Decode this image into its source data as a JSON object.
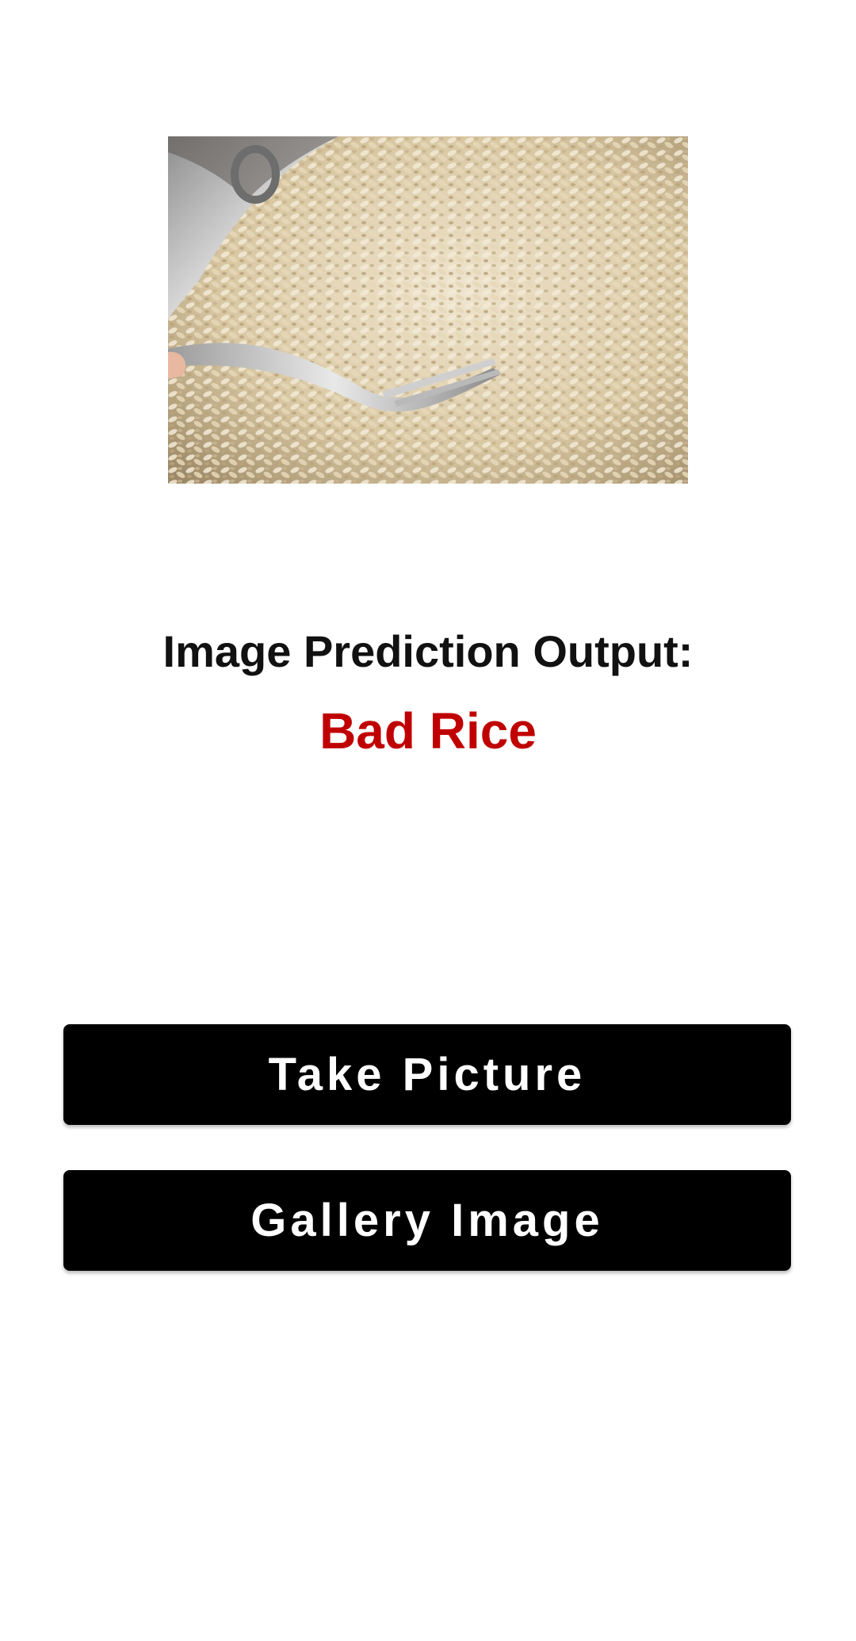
{
  "preview": {
    "image_name": "rice-photo",
    "description_icon": "fork-in-rice-image"
  },
  "result": {
    "label": "Image Prediction Output:",
    "value": "Bad Rice",
    "value_color": "#c00000"
  },
  "actions": {
    "take_picture_label": "Take Picture",
    "gallery_image_label": "Gallery Image",
    "button_color": "#000000"
  }
}
